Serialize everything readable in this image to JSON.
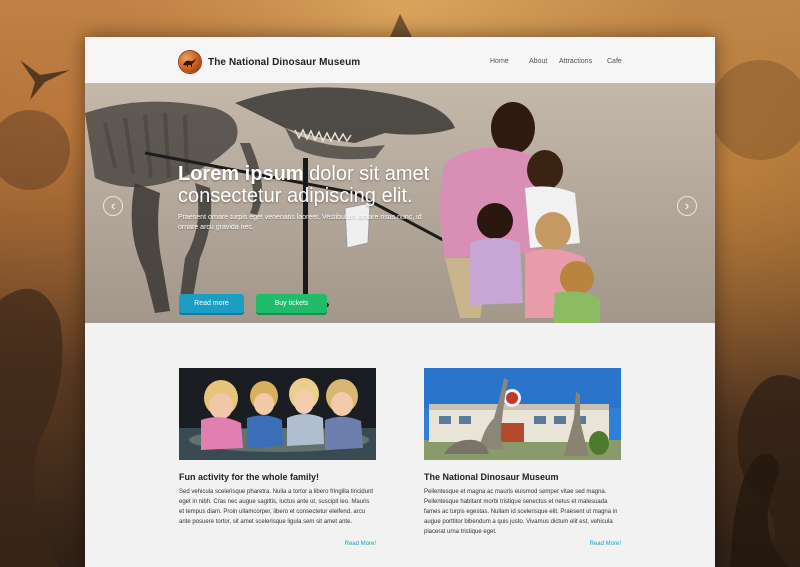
{
  "site": {
    "title": "The National Dinosaur Museum"
  },
  "nav": {
    "items": [
      "Home",
      "About",
      "Attractions",
      "Cafe"
    ]
  },
  "hero": {
    "headline_bold": "Lorem ipsum",
    "headline_rest": " dolor sit amet",
    "headline_line2": "consectetur adipiscing elit.",
    "paragraph": "Praesent ornare turpis eget venenatis laoreet. Vestibulum ornare risus nunc, id ornare arcu gravida nec.",
    "read_more_label": "Read more",
    "tickets_label": "Buy tickets",
    "prev_glyph": "‹",
    "next_glyph": "›"
  },
  "cards": [
    {
      "title": "Fun activity for the whole family!",
      "body": "Sed vehicula scelerisque pharetra. Nulla a tortor a libero fringilla tincidunt eget in nibh. Cras nec augue sagittis, luctus ante ut, suscipit leo. Mauris et tempus diam. Proin ullamcorper, libero et consectetur eleifend, arcu ante posuere tortor, sit amet scelerisque ligula sem sit amet ante.",
      "link": "Read More!"
    },
    {
      "title": "The National Dinosaur Museum",
      "body": "Pellentesque et magna ac mauris euismod semper vitae sed magna. Pellentesque habitant morbi tristique senectus et netus et malesuada fames ac turpis egestas. Nullam id scelerisque elit. Praesent ut magna in augue porttitor bibendum a quis justo. Vivamus dictum elit est, vehicula placerat urna tristique eget.",
      "link": "Read More!"
    }
  ],
  "colors": {
    "accent_blue": "#1a9ec4",
    "accent_green": "#21bb6c",
    "link": "#1a9ec4"
  }
}
